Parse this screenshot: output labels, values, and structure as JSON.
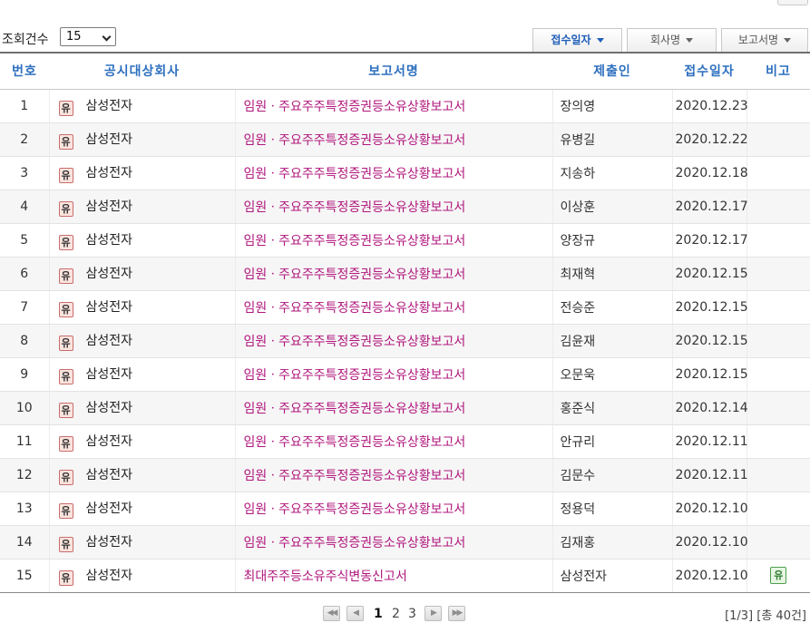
{
  "toolbar": {
    "count_label": "조회건수",
    "count_value": "15",
    "sort_buttons": [
      {
        "label": "접수일자"
      },
      {
        "label": "회사명"
      },
      {
        "label": "보고서명"
      }
    ]
  },
  "table": {
    "headers": [
      "번호",
      "공시대상회사",
      "보고서명",
      "제출인",
      "접수일자",
      "비고"
    ],
    "rows": [
      {
        "no": "1",
        "market": "유",
        "company": "삼성전자",
        "report": "임원ㆍ주요주주특정증권등소유상황보고서",
        "submitter": "장의영",
        "date": "2020.12.23",
        "note": ""
      },
      {
        "no": "2",
        "market": "유",
        "company": "삼성전자",
        "report": "임원ㆍ주요주주특정증권등소유상황보고서",
        "submitter": "유병길",
        "date": "2020.12.22",
        "note": ""
      },
      {
        "no": "3",
        "market": "유",
        "company": "삼성전자",
        "report": "임원ㆍ주요주주특정증권등소유상황보고서",
        "submitter": "지송하",
        "date": "2020.12.18",
        "note": ""
      },
      {
        "no": "4",
        "market": "유",
        "company": "삼성전자",
        "report": "임원ㆍ주요주주특정증권등소유상황보고서",
        "submitter": "이상훈",
        "date": "2020.12.17",
        "note": ""
      },
      {
        "no": "5",
        "market": "유",
        "company": "삼성전자",
        "report": "임원ㆍ주요주주특정증권등소유상황보고서",
        "submitter": "양장규",
        "date": "2020.12.17",
        "note": ""
      },
      {
        "no": "6",
        "market": "유",
        "company": "삼성전자",
        "report": "임원ㆍ주요주주특정증권등소유상황보고서",
        "submitter": "최재혁",
        "date": "2020.12.15",
        "note": ""
      },
      {
        "no": "7",
        "market": "유",
        "company": "삼성전자",
        "report": "임원ㆍ주요주주특정증권등소유상황보고서",
        "submitter": "전승준",
        "date": "2020.12.15",
        "note": ""
      },
      {
        "no": "8",
        "market": "유",
        "company": "삼성전자",
        "report": "임원ㆍ주요주주특정증권등소유상황보고서",
        "submitter": "김윤재",
        "date": "2020.12.15",
        "note": ""
      },
      {
        "no": "9",
        "market": "유",
        "company": "삼성전자",
        "report": "임원ㆍ주요주주특정증권등소유상황보고서",
        "submitter": "오문욱",
        "date": "2020.12.15",
        "note": ""
      },
      {
        "no": "10",
        "market": "유",
        "company": "삼성전자",
        "report": "임원ㆍ주요주주특정증권등소유상황보고서",
        "submitter": "홍준식",
        "date": "2020.12.14",
        "note": ""
      },
      {
        "no": "11",
        "market": "유",
        "company": "삼성전자",
        "report": "임원ㆍ주요주주특정증권등소유상황보고서",
        "submitter": "안규리",
        "date": "2020.12.11",
        "note": ""
      },
      {
        "no": "12",
        "market": "유",
        "company": "삼성전자",
        "report": "임원ㆍ주요주주특정증권등소유상황보고서",
        "submitter": "김문수",
        "date": "2020.12.11",
        "note": ""
      },
      {
        "no": "13",
        "market": "유",
        "company": "삼성전자",
        "report": "임원ㆍ주요주주특정증권등소유상황보고서",
        "submitter": "정용덕",
        "date": "2020.12.10",
        "note": ""
      },
      {
        "no": "14",
        "market": "유",
        "company": "삼성전자",
        "report": "임원ㆍ주요주주특정증권등소유상황보고서",
        "submitter": "김재홍",
        "date": "2020.12.10",
        "note": ""
      },
      {
        "no": "15",
        "market": "유",
        "company": "삼성전자",
        "report": "최대주주등소유주식변동신고서",
        "submitter": "삼성전자",
        "date": "2020.12.10",
        "note": "유"
      }
    ]
  },
  "pagination": {
    "pages": [
      "1",
      "2",
      "3"
    ],
    "current": "1",
    "summary": "[1/3] [총 40건]"
  },
  "colors": {
    "header_text": "#2d6fbf",
    "report_link": "#b0177c",
    "market_badge_bg": "#fbe4de",
    "note_badge": "#2d7a2d"
  },
  "icons": [
    "dropdown-chevron",
    "sort-triangle",
    "first-page-icon",
    "prev-page-icon",
    "next-page-icon",
    "last-page-icon"
  ]
}
